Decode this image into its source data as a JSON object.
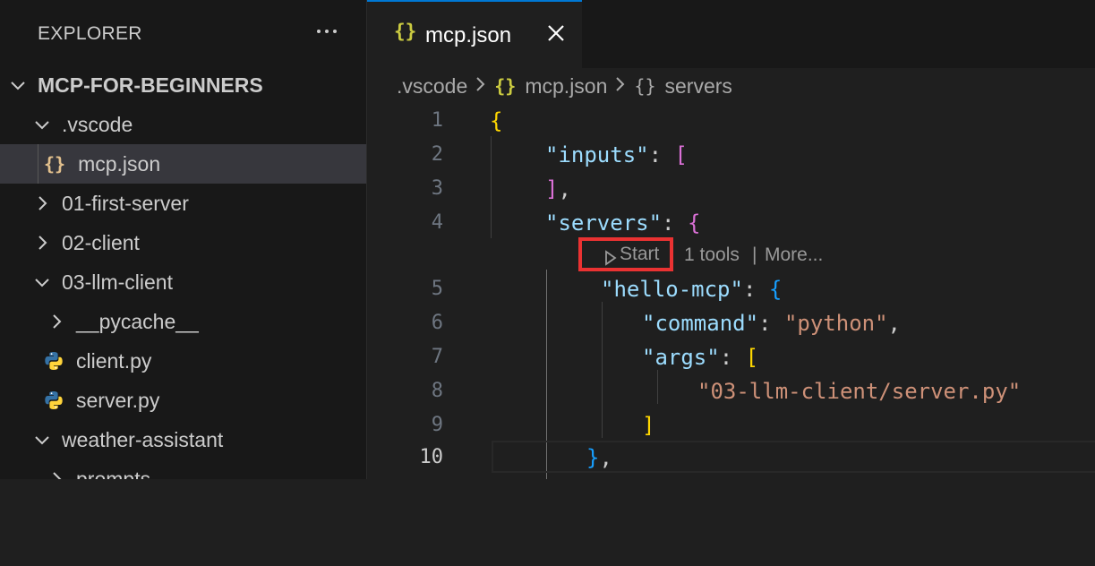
{
  "sidebar": {
    "title": "EXPLORER",
    "more_icon": "ellipsis-icon",
    "root": "MCP-FOR-BEGINNERS",
    "items": [
      {
        "label": ".vscode",
        "type": "folder",
        "expanded": true
      },
      {
        "label": "mcp.json",
        "type": "json",
        "selected": true,
        "icon_text": "{}"
      },
      {
        "label": "01-first-server",
        "type": "folder",
        "expanded": false
      },
      {
        "label": "02-client",
        "type": "folder",
        "expanded": false
      },
      {
        "label": "03-llm-client",
        "type": "folder",
        "expanded": true
      },
      {
        "label": "__pycache__",
        "type": "folder",
        "expanded": false
      },
      {
        "label": "client.py",
        "type": "python"
      },
      {
        "label": "server.py",
        "type": "python"
      },
      {
        "label": "weather-assistant",
        "type": "folder",
        "expanded": true
      },
      {
        "label": "prompts",
        "type": "folder",
        "expanded": false
      }
    ]
  },
  "editor": {
    "tab": {
      "label": "mcp.json",
      "icon_text": "{}",
      "close_icon": "close-icon"
    },
    "breadcrumb": {
      "folder": ".vscode",
      "file": "mcp.json",
      "file_icon_text": "{}",
      "symbol": "servers",
      "symbol_icon_text": "{}"
    },
    "line_numbers": [
      "1",
      "2",
      "3",
      "4",
      "5",
      "6",
      "7",
      "8",
      "9",
      "10"
    ],
    "active_line": "10",
    "codelens": {
      "start": "Start",
      "tools": "1 tools",
      "separator": "|",
      "more": "More..."
    },
    "code": {
      "l1_brace": "{",
      "l2_key": "\"inputs\"",
      "l2_colon": ": ",
      "l2_bracket": "[",
      "l3_bracket": "]",
      "l3_comma": ",",
      "l4_key": "\"servers\"",
      "l4_colon": ": ",
      "l4_brace": "{",
      "l5_key": "\"hello-mcp\"",
      "l5_colon": ": ",
      "l5_brace": "{",
      "l6_key": "\"command\"",
      "l6_colon": ": ",
      "l6_value": "\"python\"",
      "l6_comma": ",",
      "l7_key": "\"args\"",
      "l7_colon": ": ",
      "l7_bracket": "[",
      "l8_value": "\"03-llm-client/server.py\"",
      "l9_bracket": "]",
      "l10_brace": "}",
      "l10_comma": ","
    }
  },
  "colors": {
    "accent": "#0078d4",
    "highlight_box": "#ea3232",
    "json_icon": "#cbcb41",
    "python_blue": "#3572a5",
    "python_yellow": "#ffd43b"
  }
}
